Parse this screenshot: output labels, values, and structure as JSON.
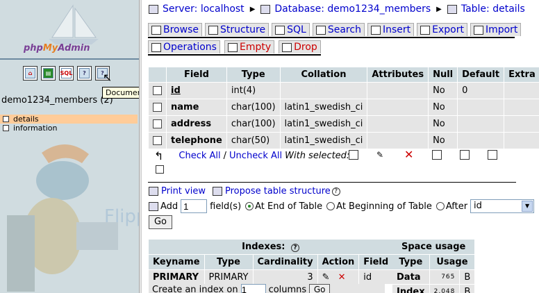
{
  "sidebar": {
    "logo": {
      "php": "php",
      "my": "My",
      "admin": "Admin"
    },
    "icons": [
      "home-icon",
      "query-window-icon",
      "sql-icon",
      "info-icon",
      "documentation-icon"
    ],
    "tooltip": "Documentation",
    "db_name": "demo1234_members (2)",
    "tables": [
      {
        "label": "details"
      },
      {
        "label": "information"
      }
    ]
  },
  "breadcrumb": {
    "server": "Server: localhost",
    "database": "Database: demo1234_members",
    "table": "Table: details"
  },
  "tabs": {
    "browse": "Browse",
    "structure": "Structure",
    "sql": "SQL",
    "search": "Search",
    "insert": "Insert",
    "export": "Export",
    "import": "Import",
    "operations": "Operations",
    "empty": "Empty",
    "drop": "Drop"
  },
  "structure": {
    "headers": {
      "field": "Field",
      "type": "Type",
      "collation": "Collation",
      "attributes": "Attributes",
      "null": "Null",
      "default": "Default",
      "extra": "Extra"
    },
    "rows": [
      {
        "field": "id",
        "type": "int(4)",
        "collation": "",
        "attributes": "",
        "null": "No",
        "default": "0",
        "extra": ""
      },
      {
        "field": "name",
        "type": "char(100)",
        "collation": "latin1_swedish_ci",
        "attributes": "",
        "null": "No",
        "default": "",
        "extra": ""
      },
      {
        "field": "address",
        "type": "char(100)",
        "collation": "latin1_swedish_ci",
        "attributes": "",
        "null": "No",
        "default": "",
        "extra": ""
      },
      {
        "field": "telephone",
        "type": "char(50)",
        "collation": "latin1_swedish_ci",
        "attributes": "",
        "null": "No",
        "default": "",
        "extra": ""
      }
    ]
  },
  "with_selected": {
    "check_all": "Check All",
    "separator": "/",
    "uncheck_all": "Uncheck All",
    "label": "With selected:"
  },
  "links": {
    "print_view": "Print view",
    "propose": "Propose table structure",
    "help": "?"
  },
  "add": {
    "label": "Add",
    "count": "1",
    "fields": "field(s)",
    "at_end": "At End of Table",
    "at_beginning": "At Beginning of Table",
    "after": "After",
    "after_field": "id",
    "go": "Go"
  },
  "indexes": {
    "title": "Indexes:",
    "help": "?",
    "headers": {
      "keyname": "Keyname",
      "type": "Type",
      "cardinality": "Cardinality",
      "action": "Action",
      "field": "Field"
    },
    "rows": [
      {
        "keyname": "PRIMARY",
        "type": "PRIMARY",
        "cardinality": "3",
        "field": "id"
      }
    ],
    "create_label": "Create an index on",
    "create_count": "1",
    "create_columns": "columns",
    "create_go": "Go"
  },
  "space": {
    "title": "Space usage",
    "headers": {
      "type": "Type",
      "usage": "Usage"
    },
    "rows": [
      {
        "type": "Data",
        "value": "765",
        "unit": "B"
      },
      {
        "type": "Index",
        "value": "2,048",
        "unit": "B"
      }
    ]
  },
  "colors": {
    "header_bg": "#d0dce0",
    "row_bg": "#e5e5e5",
    "active_table": "#ffcc99",
    "link": "#0000cc",
    "danger": "#cc0000"
  }
}
